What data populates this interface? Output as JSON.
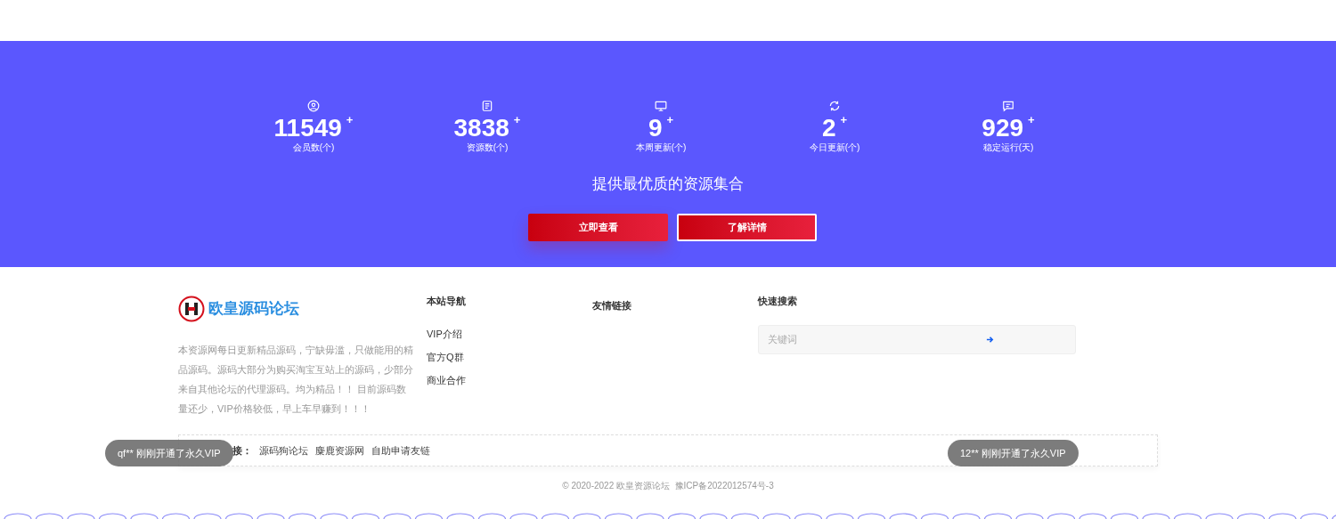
{
  "stats": [
    {
      "value": "11549",
      "sup": "+",
      "label": "会员数(个)"
    },
    {
      "value": "3838",
      "sup": "+",
      "label": "资源数(个)"
    },
    {
      "value": "9",
      "sup": "+",
      "label": "本周更新(个)"
    },
    {
      "value": "2",
      "sup": "+",
      "label": "今日更新(个)"
    },
    {
      "value": "929",
      "sup": "+",
      "label": "稳定运行(天)"
    }
  ],
  "slogan": "提供最优质的资源集合",
  "buttons": [
    {
      "label": "立即查看",
      "kind": "solid"
    },
    {
      "label": "了解详情",
      "kind": "outline"
    }
  ],
  "footer": {
    "logo_text": "欧皇源码论坛",
    "description": "本资源网每日更新精品源码，宁缺毋滥，只做能用的精品源码。源码大部分为购买淘宝互站上的源码，少部分来自其他论坛的代理源码。均为精品！！ 目前源码数量还少，VIP价格较低，早上车早赚到！！！",
    "nav_title": "本站导航",
    "nav_items": [
      "VIP介绍",
      "官方Q群",
      "商业合作"
    ],
    "links_title": "友情链接",
    "search_title": "快速搜索",
    "search": {
      "placeholder": "关键词"
    }
  },
  "friend_links": {
    "label": "接：",
    "items": [
      "源码狗论坛",
      "麋鹿资源网",
      "自助申请友链"
    ]
  },
  "toasts": [
    "qf** 刚刚开通了永久VIP",
    "12** 刚刚开通了永久VIP"
  ],
  "copyright": "© 2020-2022 欧皇资源论坛  豫ICP备2022012574号-3"
}
